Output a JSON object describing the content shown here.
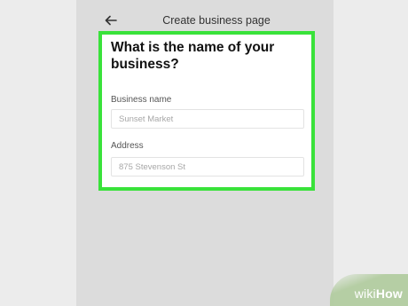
{
  "header": {
    "back_icon": "arrow-left-icon",
    "title": "Create business page"
  },
  "form": {
    "heading": "What is the name of your business?",
    "business_name": {
      "label": "Business name",
      "value": "Sunset Market"
    },
    "address": {
      "label": "Address",
      "value": "875 Stevenson St"
    }
  },
  "highlight": {
    "color": "#39e23a"
  },
  "watermark": {
    "wiki": "wiki",
    "how": "How"
  }
}
